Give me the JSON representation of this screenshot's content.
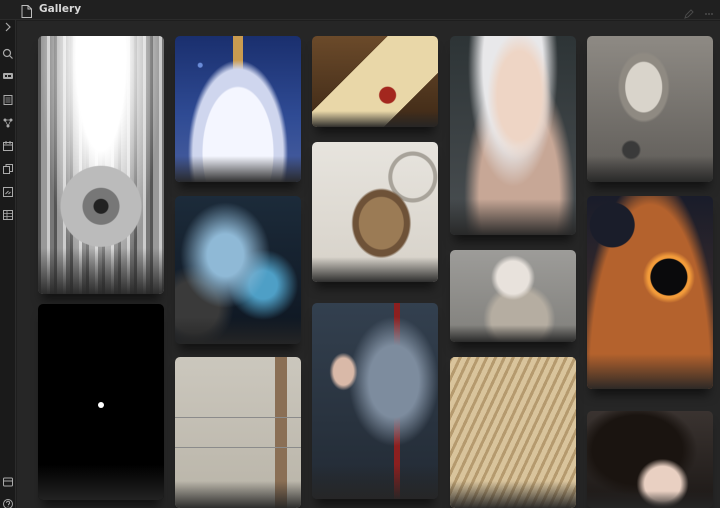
{
  "window": {
    "title": "Gallery"
  },
  "ribbon": {
    "icons": [
      "chevron-right-icon",
      "search-icon",
      "tag-icon",
      "file-list-icon",
      "graph-icon",
      "calendar-icon",
      "copy-icon",
      "terminal-icon",
      "table-icon",
      "folder-icon",
      "help-icon"
    ]
  },
  "gallery": {
    "images": [
      {
        "subject": "robot-machine",
        "tone": "grayscale"
      },
      {
        "subject": "black-square-dot",
        "tone": "dark"
      },
      {
        "subject": "potion-flask",
        "tone": "blue"
      },
      {
        "subject": "hooded-warrior",
        "tone": "dark-blue"
      },
      {
        "subject": "weapon-sketches",
        "tone": "paper"
      },
      {
        "subject": "wax-seal-letters",
        "tone": "warm"
      },
      {
        "subject": "crab-creature-sketch",
        "tone": "light"
      },
      {
        "subject": "armored-knight-maiden",
        "tone": "steel-blue"
      },
      {
        "subject": "white-haired-woman",
        "tone": "muted"
      },
      {
        "subject": "pale-woman-back",
        "tone": "gray"
      },
      {
        "subject": "open-book",
        "tone": "sepia"
      },
      {
        "subject": "skull-monster",
        "tone": "gray"
      },
      {
        "subject": "cosmic-planets",
        "tone": "fiery"
      },
      {
        "subject": "dark-haired-girl",
        "tone": "dark"
      }
    ]
  }
}
